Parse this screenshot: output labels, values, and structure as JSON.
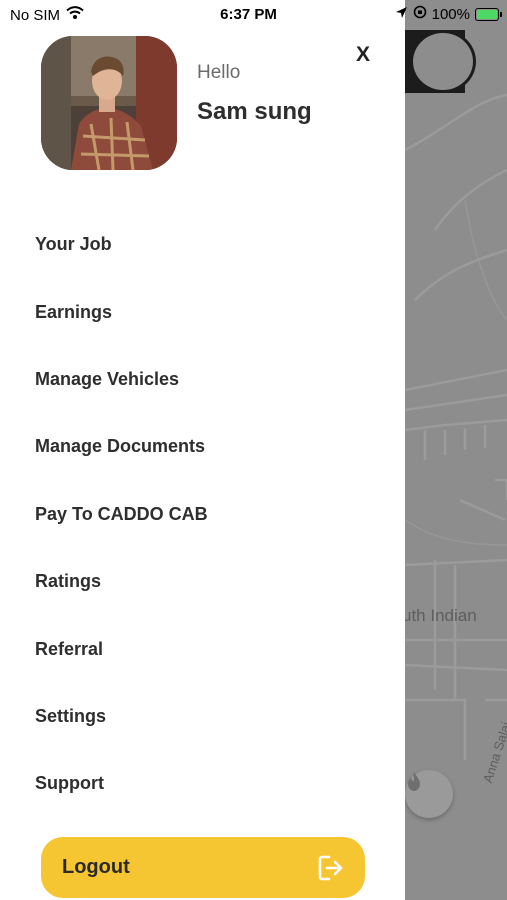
{
  "status_bar": {
    "carrier": "No SIM",
    "time": "6:37 PM",
    "battery": "100%",
    "battery_level": 1.0,
    "icons": [
      "wifi-icon",
      "location-arrow-icon",
      "orientation-lock-icon",
      "battery-charging-icon"
    ]
  },
  "drawer": {
    "greeting": "Hello",
    "user_name": "Sam sung",
    "close_label": "X",
    "menu": [
      {
        "label": "Your Job"
      },
      {
        "label": "Earnings"
      },
      {
        "label": "Manage Vehicles"
      },
      {
        "label": "Manage Documents"
      },
      {
        "label": "Pay To CADDO CAB"
      },
      {
        "label": "Ratings"
      },
      {
        "label": "Referral"
      },
      {
        "label": "Settings"
      },
      {
        "label": "Support"
      }
    ],
    "logout_label": "Logout",
    "logout_icon": "logout-icon"
  },
  "map": {
    "place_label": "uth Indian",
    "road_label": "Anna Salai",
    "fire_icon": "flame-icon"
  },
  "colors": {
    "accent": "#f5c631",
    "overlay": "#8d8d8d",
    "text": "#2e2e2e"
  }
}
